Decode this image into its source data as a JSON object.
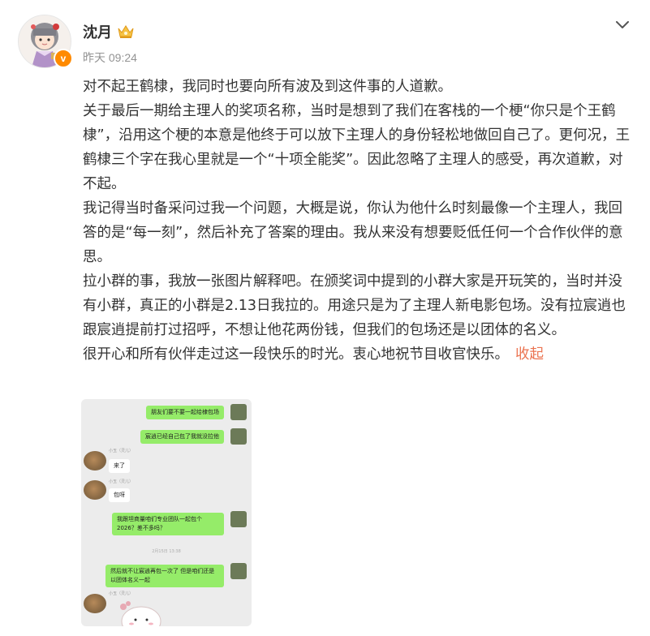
{
  "header": {
    "username": "沈月",
    "time": "昨天 09:24",
    "verified_badge": "v",
    "icons": [
      "crown-icon",
      "chevron-down-icon",
      "verified-badge-icon"
    ]
  },
  "content": {
    "paragraphs": [
      "对不起王鹤棣，我同时也要向所有波及到这件事的人道歉。",
      "关于最后一期给主理人的奖项名称，当时是想到了我们在客栈的一个梗“你只是个王鹤棣”，沿用这个梗的本意是他终于可以放下主理人的身份轻松地做回自己了。更何况，王鹤棣三个字在我心里就是一个“十项全能奖”。因此忽略了主理人的感受，再次道歉，对不起。",
      "我记得当时备采问过我一个问题，大概是说，你认为他什么时刻最像一个主理人，我回答的是“每一刻”，然后补充了答案的理由。我从来没有想要贬低任何一个合作伙伴的意思。",
      "拉小群的事，我放一张图片解释吧。在颁奖词中提到的小群大家是开玩笑的，当时并没有小群，真正的小群是2.13日我拉的。用途只是为了主理人新电影包场。没有拉宸逍也跟宸逍提前打过招呼，不想让他花两份钱，但我们的包场还是以团体的名义。",
      "很开心和所有伙伴走过这一段快乐的时光。衷心地祝节目收官快乐。"
    ],
    "collapse_label": "收起"
  },
  "chat_image": {
    "messages": [
      {
        "side": "right",
        "text": "朋友们要不要一起给棣包场"
      },
      {
        "side": "right",
        "text": "宸逍已经自己包了我就没拉他"
      },
      {
        "side": "left",
        "nick": "小玉（灵儿）",
        "text": "来了"
      },
      {
        "side": "left",
        "nick": "小玉（灵儿）",
        "text": "包呀"
      },
      {
        "side": "right",
        "text": "我跟坦商量咱们专业团队一起包个2026？差不多吗？"
      },
      {
        "side": "center",
        "text": "2月15日 13:38"
      },
      {
        "side": "right",
        "text": "然后就不让宸逍再包一次了 但是咱们还是以团体名义一起"
      },
      {
        "side": "left",
        "nick": "小玉（灵儿）",
        "text": ""
      }
    ]
  },
  "colors": {
    "link": "#eb7350",
    "text": "#333333",
    "muted": "#939393",
    "chat_green": "#95ec69",
    "badge": "#ff8a00"
  }
}
